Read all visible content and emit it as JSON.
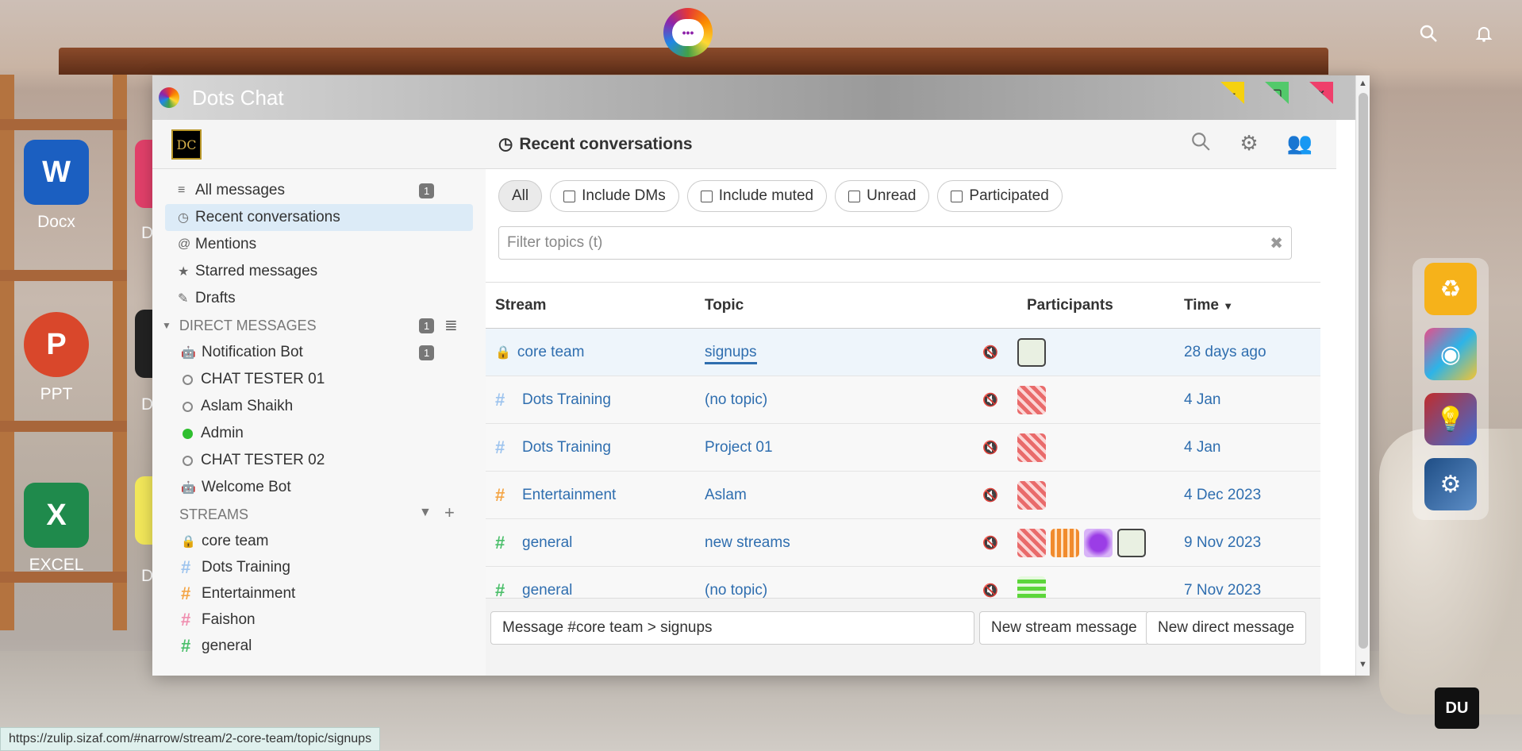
{
  "desktop": {
    "icons": [
      {
        "label": "Docx",
        "glyph": "W",
        "color": "#1b5fc1"
      },
      {
        "label": "PPT",
        "glyph": "P",
        "color": "#d9472b"
      },
      {
        "label": "EXCEL",
        "glyph": "X",
        "color": "#1f8a4c"
      }
    ],
    "partial_labels": [
      "D",
      "D",
      "D"
    ],
    "search_icon": "search-icon",
    "bell_icon": "bell-icon",
    "corner_badge": "DU"
  },
  "window": {
    "title": "Dots Chat"
  },
  "header": {
    "logo_text": "DC",
    "title": "Recent conversations"
  },
  "sidebar": {
    "views": [
      {
        "label": "All messages",
        "icon": "≡",
        "badge": "1"
      },
      {
        "label": "Recent conversations",
        "icon": "◷",
        "badge": ""
      },
      {
        "label": "Mentions",
        "icon": "@",
        "badge": ""
      },
      {
        "label": "Starred messages",
        "icon": "★",
        "badge": ""
      },
      {
        "label": "Drafts",
        "icon": "✎",
        "badge": ""
      }
    ],
    "dm_heading": "DIRECT MESSAGES",
    "dm_badge": "1",
    "dms": [
      {
        "label": "Notification Bot",
        "status": "bot",
        "badge": "1"
      },
      {
        "label": "CHAT TESTER 01",
        "status": "offline",
        "badge": ""
      },
      {
        "label": "Aslam Shaikh",
        "status": "offline",
        "badge": ""
      },
      {
        "label": "Admin",
        "status": "online",
        "badge": ""
      },
      {
        "label": "CHAT TESTER 02",
        "status": "offline",
        "badge": ""
      },
      {
        "label": "Welcome Bot",
        "status": "bot",
        "badge": ""
      }
    ],
    "streams_heading": "STREAMS",
    "streams": [
      {
        "label": "core team",
        "icon": "lock",
        "color": "#f2c94c"
      },
      {
        "label": "Dots Training",
        "icon": "#",
        "color": "#9ec4ee"
      },
      {
        "label": "Entertainment",
        "icon": "#",
        "color": "#f4a546"
      },
      {
        "label": "Faishon",
        "icon": "#",
        "color": "#f08fb0"
      },
      {
        "label": "general",
        "icon": "#",
        "color": "#4cbf6b"
      }
    ]
  },
  "filters": {
    "all": "All",
    "include_dms": "Include DMs",
    "include_muted": "Include muted",
    "unread": "Unread",
    "participated": "Participated",
    "search_placeholder": "Filter topics (t)"
  },
  "table": {
    "headers": {
      "stream": "Stream",
      "topic": "Topic",
      "participants": "Participants",
      "time": "Time"
    },
    "rows": [
      {
        "stream": "core team",
        "stream_icon": "lock",
        "stream_color": "#f2c94c",
        "topic": "signups",
        "time": "28 days ago",
        "avatars": [
          "bot"
        ]
      },
      {
        "stream": "Dots Training",
        "stream_icon": "#",
        "stream_color": "#9ec4ee",
        "topic": "(no topic)",
        "time": "4 Jan",
        "avatars": [
          "red"
        ]
      },
      {
        "stream": "Dots Training",
        "stream_icon": "#",
        "stream_color": "#9ec4ee",
        "topic": "Project 01",
        "time": "4 Jan",
        "avatars": [
          "red"
        ]
      },
      {
        "stream": "Entertainment",
        "stream_icon": "#",
        "stream_color": "#f4a546",
        "topic": "Aslam",
        "time": "4 Dec 2023",
        "avatars": [
          "red"
        ]
      },
      {
        "stream": "general",
        "stream_icon": "#",
        "stream_color": "#4cbf6b",
        "topic": "new streams",
        "time": "9 Nov 2023",
        "avatars": [
          "red",
          "orange",
          "purple",
          "bot"
        ]
      },
      {
        "stream": "general",
        "stream_icon": "#",
        "stream_color": "#4cbf6b",
        "topic": "(no topic)",
        "time": "7 Nov 2023",
        "avatars": [
          "green"
        ]
      }
    ]
  },
  "compose": {
    "placeholder": "Message #core team > signups",
    "new_stream": "New stream message",
    "new_dm": "New direct message"
  },
  "statusbar": {
    "url": "https://zulip.sizaf.com/#narrow/stream/2-core-team/topic/signups"
  }
}
